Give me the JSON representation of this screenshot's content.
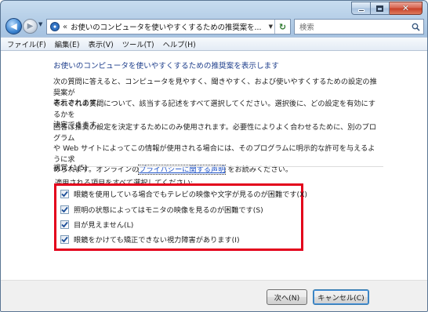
{
  "window": {
    "controls": {
      "min": "minimize-icon",
      "max": "maximize-icon",
      "close": "close-icon"
    }
  },
  "nav": {
    "address_prefix": "«",
    "address_text": "お使いのコンピュータを使いやすくするための推奨案を...",
    "search_placeholder": "検索"
  },
  "menu": [
    "ファイル(F)",
    "編集(E)",
    "表示(V)",
    "ツール(T)",
    "ヘルプ(H)"
  ],
  "content": {
    "heading": "お使いのコンピュータを使いやすくするための推奨案を表示します",
    "para1_line1": "次の質問に答えると、コンピュータを見やすく、聞きやすく、および使いやすくするための設定の推奨案が",
    "para1_line2": "表示されます。",
    "para2_line1": "それぞれの質問について、該当する記述をすべて選択してください。選択後に、どの設定を有効にするかを",
    "para2_line2": "決定できます。",
    "para3_line1": "回答は推奨の設定を決定するためにのみ使用されます。必要性によりよく合わせるために、別のプログラム",
    "para3_line2": "や Web サイトによってこの情報が使用される場合には、そのプログラムに明示的な許可を与えるように求",
    "para3_line3_pre": "められます。オンラインの",
    "privacy_link": "プライバシーに関する声明",
    "para3_line3_post": "をお読みください。",
    "section_title": "視覚 (1/5)",
    "instruction": "適用される項目をすべて選択してください:",
    "options": [
      {
        "label": "眼鏡を使用している場合でもテレビの映像や文字が見るのが困難です(X)",
        "checked": true
      },
      {
        "label": "照明の状態によってはモニタの映像を見るのが困難です(S)",
        "checked": true
      },
      {
        "label": "目が見えません(L)",
        "checked": true
      },
      {
        "label": "眼鏡をかけても矯正できない視力障害があります(I)",
        "checked": true
      }
    ],
    "highlight_color": "#e3001b"
  },
  "footer": {
    "next_label": "次へ(N)",
    "cancel_label": "キャンセル(C)"
  }
}
